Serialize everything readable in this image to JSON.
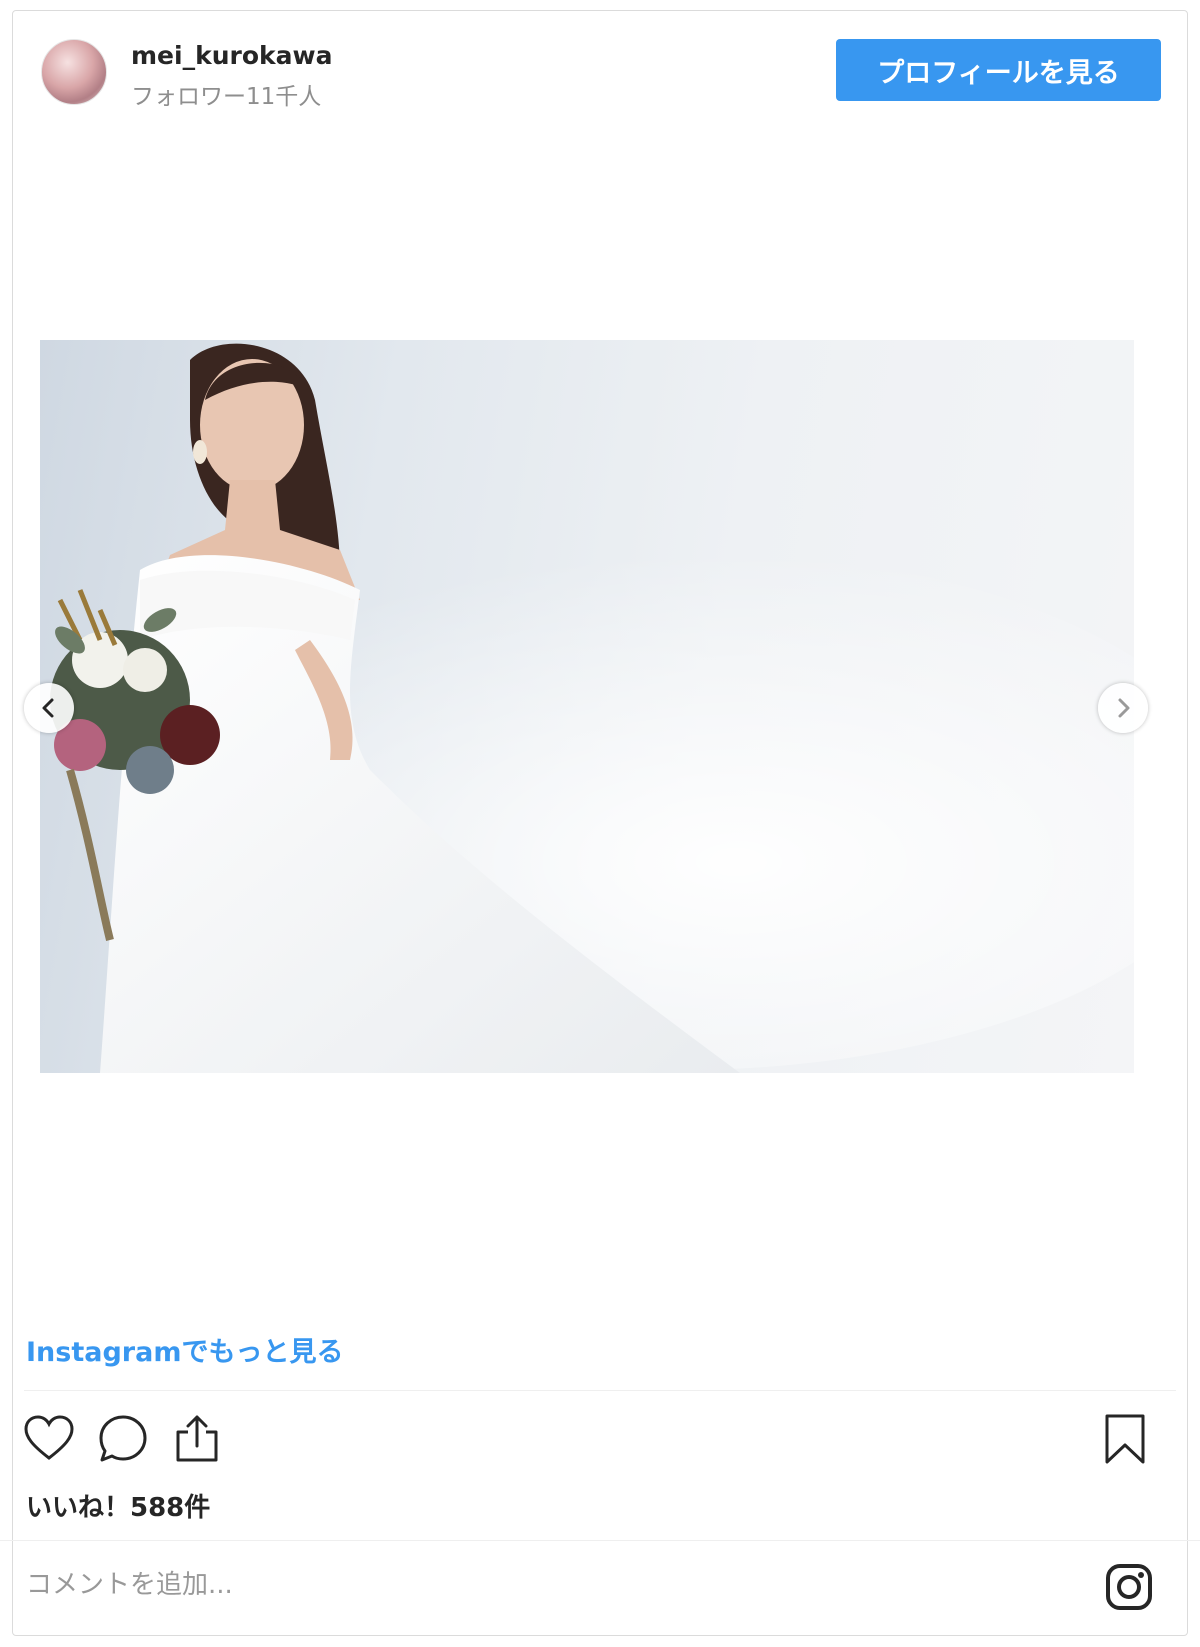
{
  "header": {
    "username": "mei_kurokawa",
    "followers": "フォロワー11千人",
    "profile_button": "プロフィールを見る"
  },
  "post": {
    "more_link": "Instagramでもっと見る",
    "likes": "いいね！588件",
    "comment_placeholder": "コメントを追加..."
  },
  "icons": {
    "avatar": "avatar",
    "prev": "chevron-left-icon",
    "next": "chevron-right-icon",
    "like": "heart-icon",
    "comment": "comment-icon",
    "share": "share-icon",
    "save": "bookmark-icon",
    "logo": "instagram-icon"
  },
  "colors": {
    "accent": "#3897f0",
    "text": "#262626",
    "muted": "#8e8e8e"
  }
}
